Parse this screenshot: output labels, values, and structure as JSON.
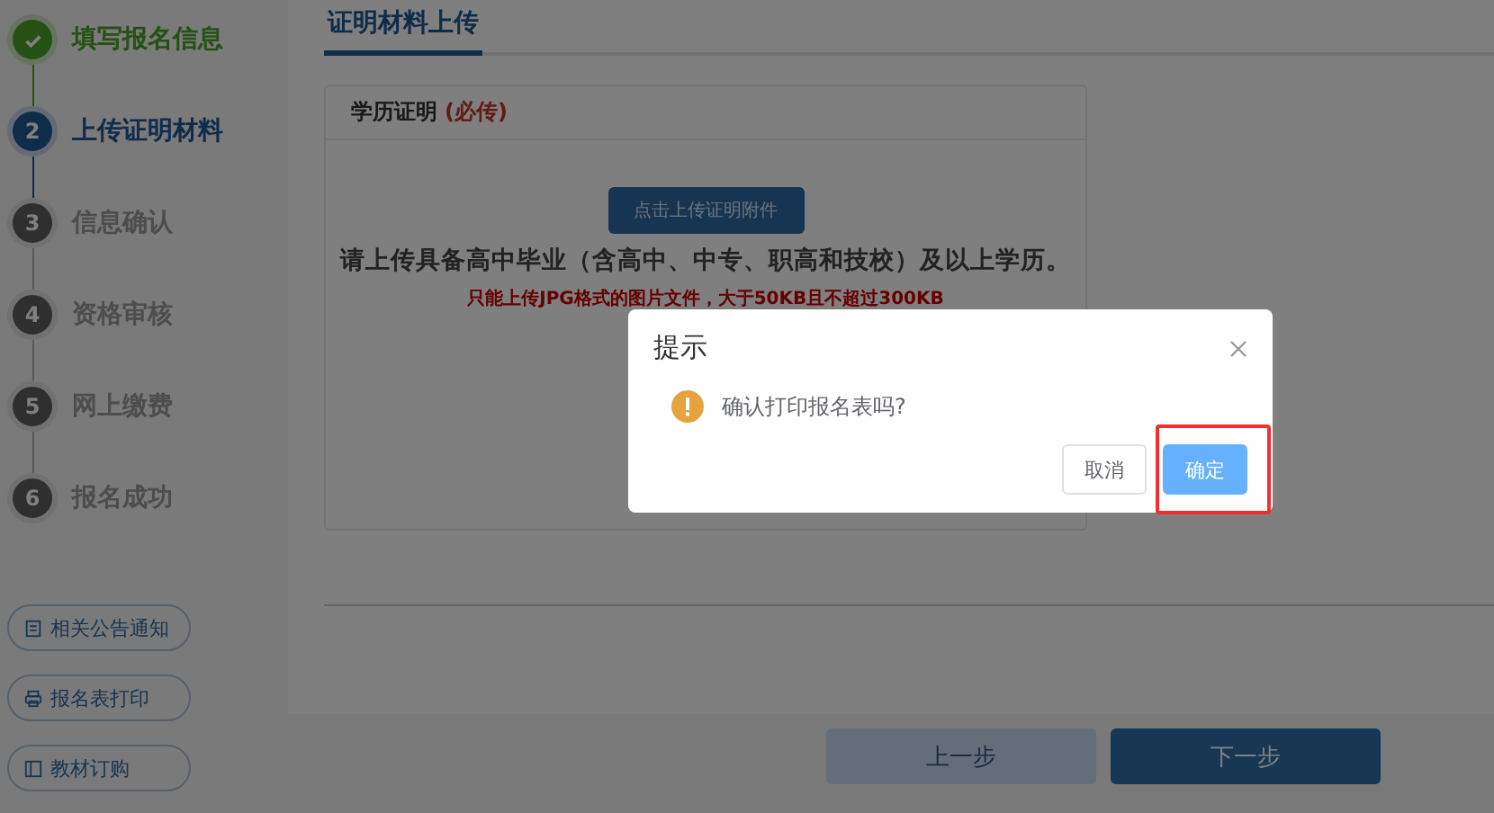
{
  "steps": [
    {
      "label": "填写报名信息",
      "done": true,
      "current": false
    },
    {
      "number": "2",
      "label": "上传证明材料",
      "done": false,
      "current": true
    },
    {
      "number": "3",
      "label": "信息确认",
      "done": false,
      "current": false
    },
    {
      "number": "4",
      "label": "资格审核",
      "done": false,
      "current": false
    },
    {
      "number": "5",
      "label": "网上缴费",
      "done": false,
      "current": false
    },
    {
      "number": "6",
      "label": "报名成功",
      "done": false,
      "current": false
    }
  ],
  "side_links": [
    {
      "label": "相关公告通知"
    },
    {
      "label": "报名表打印"
    },
    {
      "label": "教材订购"
    }
  ],
  "tab": {
    "label": "证明材料上传",
    "selected": true
  },
  "card": {
    "title": "学历证明",
    "required": "(必传)",
    "upload_button": "点击上传证明附件",
    "hint": "请上传具备高中毕业（含高中、中专、职高和技校）及以上学历。",
    "rule": "只能上传JPG格式的图片文件，大于50KB且不超过300KB"
  },
  "footer": {
    "prev": "上一步",
    "next": "下一步"
  },
  "dialog": {
    "title": "提示",
    "message": "确认打印报名表吗?",
    "cancel": "取消",
    "confirm": "确定"
  }
}
